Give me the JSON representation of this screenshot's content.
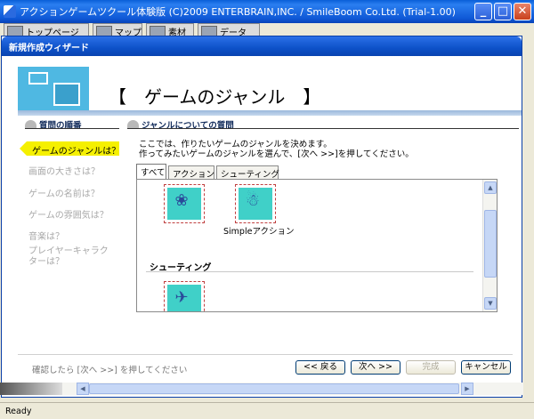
{
  "app": {
    "title": "アクションゲームツクール体験版 (C)2009 ENTERBRAIN,INC. / SmileBoom Co.Ltd. (Trial-1.00)",
    "toolbar_tabs": [
      "トップページ",
      "マップ",
      "素材",
      "データ"
    ]
  },
  "wizard": {
    "title": "新規作成ウィザード",
    "header_title": "【　ゲームのジャンル　】",
    "steps_heading": "質問の順番",
    "question_heading": "ジャンルについての質問",
    "steps": [
      {
        "label": "ゲームのジャンルは？",
        "active": true
      },
      {
        "label": "画面の大きさは？"
      },
      {
        "label": "ゲームの名前は？"
      },
      {
        "label": "ゲームの雰囲気は？"
      },
      {
        "label": "音楽は？"
      },
      {
        "label": "プレイヤーキャラク"
      },
      {
        "label": "ターは？"
      }
    ],
    "description_line1": "ここでは、作りたいゲームのジャンルを決めます。",
    "description_line2": "作ってみたいゲームのジャンルを選んで、[次へ >>]を押してください。",
    "tabs": [
      "すべて",
      "アクション",
      "シューティング"
    ],
    "items": [
      {
        "label": ""
      },
      {
        "label": "Simpleアクション"
      }
    ],
    "group_shooting": "シューティング",
    "footer_hint": "確認したら [次へ >>] を押してください",
    "buttons": {
      "back": "<< 戻る",
      "next": "次へ >>",
      "finish": "完成",
      "cancel": "キャンセル"
    }
  },
  "status": {
    "text": "Ready"
  }
}
